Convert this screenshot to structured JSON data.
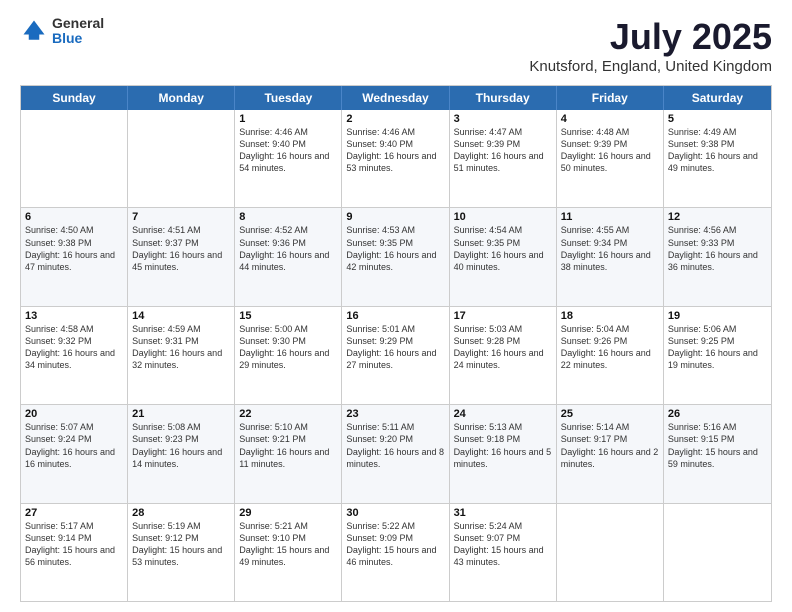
{
  "logo": {
    "general": "General",
    "blue": "Blue"
  },
  "title": "July 2025",
  "subtitle": "Knutsford, England, United Kingdom",
  "days": [
    "Sunday",
    "Monday",
    "Tuesday",
    "Wednesday",
    "Thursday",
    "Friday",
    "Saturday"
  ],
  "weeks": [
    [
      {
        "day": "",
        "sunrise": "",
        "sunset": "",
        "daylight": ""
      },
      {
        "day": "",
        "sunrise": "",
        "sunset": "",
        "daylight": ""
      },
      {
        "day": "1",
        "sunrise": "Sunrise: 4:46 AM",
        "sunset": "Sunset: 9:40 PM",
        "daylight": "Daylight: 16 hours and 54 minutes."
      },
      {
        "day": "2",
        "sunrise": "Sunrise: 4:46 AM",
        "sunset": "Sunset: 9:40 PM",
        "daylight": "Daylight: 16 hours and 53 minutes."
      },
      {
        "day": "3",
        "sunrise": "Sunrise: 4:47 AM",
        "sunset": "Sunset: 9:39 PM",
        "daylight": "Daylight: 16 hours and 51 minutes."
      },
      {
        "day": "4",
        "sunrise": "Sunrise: 4:48 AM",
        "sunset": "Sunset: 9:39 PM",
        "daylight": "Daylight: 16 hours and 50 minutes."
      },
      {
        "day": "5",
        "sunrise": "Sunrise: 4:49 AM",
        "sunset": "Sunset: 9:38 PM",
        "daylight": "Daylight: 16 hours and 49 minutes."
      }
    ],
    [
      {
        "day": "6",
        "sunrise": "Sunrise: 4:50 AM",
        "sunset": "Sunset: 9:38 PM",
        "daylight": "Daylight: 16 hours and 47 minutes."
      },
      {
        "day": "7",
        "sunrise": "Sunrise: 4:51 AM",
        "sunset": "Sunset: 9:37 PM",
        "daylight": "Daylight: 16 hours and 45 minutes."
      },
      {
        "day": "8",
        "sunrise": "Sunrise: 4:52 AM",
        "sunset": "Sunset: 9:36 PM",
        "daylight": "Daylight: 16 hours and 44 minutes."
      },
      {
        "day": "9",
        "sunrise": "Sunrise: 4:53 AM",
        "sunset": "Sunset: 9:35 PM",
        "daylight": "Daylight: 16 hours and 42 minutes."
      },
      {
        "day": "10",
        "sunrise": "Sunrise: 4:54 AM",
        "sunset": "Sunset: 9:35 PM",
        "daylight": "Daylight: 16 hours and 40 minutes."
      },
      {
        "day": "11",
        "sunrise": "Sunrise: 4:55 AM",
        "sunset": "Sunset: 9:34 PM",
        "daylight": "Daylight: 16 hours and 38 minutes."
      },
      {
        "day": "12",
        "sunrise": "Sunrise: 4:56 AM",
        "sunset": "Sunset: 9:33 PM",
        "daylight": "Daylight: 16 hours and 36 minutes."
      }
    ],
    [
      {
        "day": "13",
        "sunrise": "Sunrise: 4:58 AM",
        "sunset": "Sunset: 9:32 PM",
        "daylight": "Daylight: 16 hours and 34 minutes."
      },
      {
        "day": "14",
        "sunrise": "Sunrise: 4:59 AM",
        "sunset": "Sunset: 9:31 PM",
        "daylight": "Daylight: 16 hours and 32 minutes."
      },
      {
        "day": "15",
        "sunrise": "Sunrise: 5:00 AM",
        "sunset": "Sunset: 9:30 PM",
        "daylight": "Daylight: 16 hours and 29 minutes."
      },
      {
        "day": "16",
        "sunrise": "Sunrise: 5:01 AM",
        "sunset": "Sunset: 9:29 PM",
        "daylight": "Daylight: 16 hours and 27 minutes."
      },
      {
        "day": "17",
        "sunrise": "Sunrise: 5:03 AM",
        "sunset": "Sunset: 9:28 PM",
        "daylight": "Daylight: 16 hours and 24 minutes."
      },
      {
        "day": "18",
        "sunrise": "Sunrise: 5:04 AM",
        "sunset": "Sunset: 9:26 PM",
        "daylight": "Daylight: 16 hours and 22 minutes."
      },
      {
        "day": "19",
        "sunrise": "Sunrise: 5:06 AM",
        "sunset": "Sunset: 9:25 PM",
        "daylight": "Daylight: 16 hours and 19 minutes."
      }
    ],
    [
      {
        "day": "20",
        "sunrise": "Sunrise: 5:07 AM",
        "sunset": "Sunset: 9:24 PM",
        "daylight": "Daylight: 16 hours and 16 minutes."
      },
      {
        "day": "21",
        "sunrise": "Sunrise: 5:08 AM",
        "sunset": "Sunset: 9:23 PM",
        "daylight": "Daylight: 16 hours and 14 minutes."
      },
      {
        "day": "22",
        "sunrise": "Sunrise: 5:10 AM",
        "sunset": "Sunset: 9:21 PM",
        "daylight": "Daylight: 16 hours and 11 minutes."
      },
      {
        "day": "23",
        "sunrise": "Sunrise: 5:11 AM",
        "sunset": "Sunset: 9:20 PM",
        "daylight": "Daylight: 16 hours and 8 minutes."
      },
      {
        "day": "24",
        "sunrise": "Sunrise: 5:13 AM",
        "sunset": "Sunset: 9:18 PM",
        "daylight": "Daylight: 16 hours and 5 minutes."
      },
      {
        "day": "25",
        "sunrise": "Sunrise: 5:14 AM",
        "sunset": "Sunset: 9:17 PM",
        "daylight": "Daylight: 16 hours and 2 minutes."
      },
      {
        "day": "26",
        "sunrise": "Sunrise: 5:16 AM",
        "sunset": "Sunset: 9:15 PM",
        "daylight": "Daylight: 15 hours and 59 minutes."
      }
    ],
    [
      {
        "day": "27",
        "sunrise": "Sunrise: 5:17 AM",
        "sunset": "Sunset: 9:14 PM",
        "daylight": "Daylight: 15 hours and 56 minutes."
      },
      {
        "day": "28",
        "sunrise": "Sunrise: 5:19 AM",
        "sunset": "Sunset: 9:12 PM",
        "daylight": "Daylight: 15 hours and 53 minutes."
      },
      {
        "day": "29",
        "sunrise": "Sunrise: 5:21 AM",
        "sunset": "Sunset: 9:10 PM",
        "daylight": "Daylight: 15 hours and 49 minutes."
      },
      {
        "day": "30",
        "sunrise": "Sunrise: 5:22 AM",
        "sunset": "Sunset: 9:09 PM",
        "daylight": "Daylight: 15 hours and 46 minutes."
      },
      {
        "day": "31",
        "sunrise": "Sunrise: 5:24 AM",
        "sunset": "Sunset: 9:07 PM",
        "daylight": "Daylight: 15 hours and 43 minutes."
      },
      {
        "day": "",
        "sunrise": "",
        "sunset": "",
        "daylight": ""
      },
      {
        "day": "",
        "sunrise": "",
        "sunset": "",
        "daylight": ""
      }
    ]
  ]
}
